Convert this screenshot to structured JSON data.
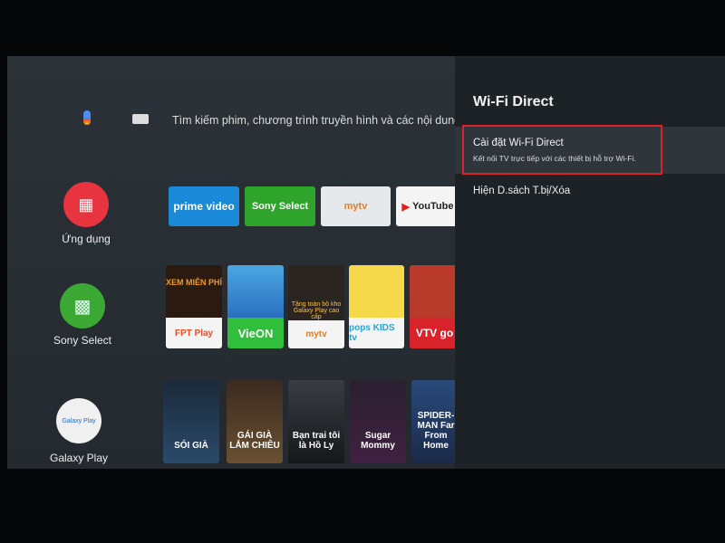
{
  "search": {
    "placeholder": "Tìm kiếm phim, chương trình truyền hình và các nội dung khác"
  },
  "sidebar": [
    {
      "label": "Ứng dụng",
      "icon": "apps-grid-icon",
      "color": "#e8343f"
    },
    {
      "label": "Sony Select",
      "icon": "sony-select-icon",
      "color": "#3aa832"
    },
    {
      "label": "Galaxy Play",
      "icon": "galaxy-play-logo",
      "color": "#f0f0f0"
    }
  ],
  "apps_row": [
    {
      "label": "prime video",
      "color": "#1a8ad8"
    },
    {
      "label": "Sony Select",
      "color": "#2ea52a"
    },
    {
      "label": "mytv",
      "color": "#e6e9ec"
    },
    {
      "label": "YouTube",
      "color": "#f4f4f4"
    }
  ],
  "channels_row": [
    {
      "title": "XEM MIỄN PHÍ",
      "label": "FPT Play"
    },
    {
      "title": "",
      "label": "VieON"
    },
    {
      "title": "Tặng toàn bộ kho Galaxy Play cao cấp",
      "label": "mytv"
    },
    {
      "title": "",
      "label": "pops KIDS tv"
    },
    {
      "title": "",
      "label": "VTV go"
    }
  ],
  "movies_row": [
    {
      "title": "SÓI GIÀ"
    },
    {
      "title": "GÁI GIÀ LẮM CHIÊU"
    },
    {
      "title": "Bạn trai tôi là Hồ Ly"
    },
    {
      "title": "Sugar Mommy"
    },
    {
      "title": "SPIDER-MAN Far From Home"
    }
  ],
  "panel": {
    "title": "Wi-Fi Direct",
    "options": [
      {
        "label": "Cài đặt Wi-Fi Direct",
        "subtitle": "Kết nối TV trực tiếp với các thiết bị hỗ trợ Wi-Fi.",
        "selected": true
      },
      {
        "label": "Hiện D.sách T.bị/Xóa"
      }
    ]
  },
  "colors": {
    "highlight": "#d8232a"
  }
}
